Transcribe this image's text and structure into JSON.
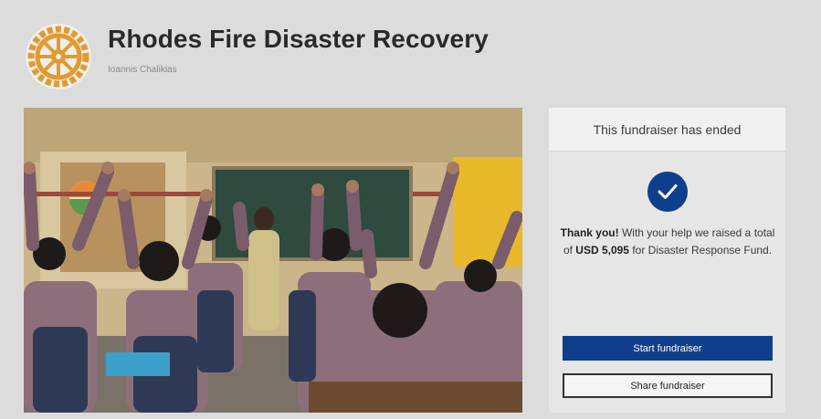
{
  "header": {
    "title": "Rhodes Fire Disaster Recovery",
    "organizer": "Ioannis Chalikias",
    "logo_icon": "rotary-wheel-icon",
    "logo_color": "#e39a2d"
  },
  "photo": {
    "icon": "classroom-photo"
  },
  "panel": {
    "status": "This fundraiser has ended",
    "status_icon": "checkmark-circle-icon",
    "thanks_bold": "Thank you!",
    "thanks_text_1": " With your help we raised a total of ",
    "amount": "USD 5,095",
    "thanks_text_2": " for Disaster Response Fund.",
    "start_button": "Start fundraiser",
    "share_button": "Share fundraiser"
  },
  "colors": {
    "accent": "#0f3f8c",
    "background": "#dcdcdc"
  }
}
